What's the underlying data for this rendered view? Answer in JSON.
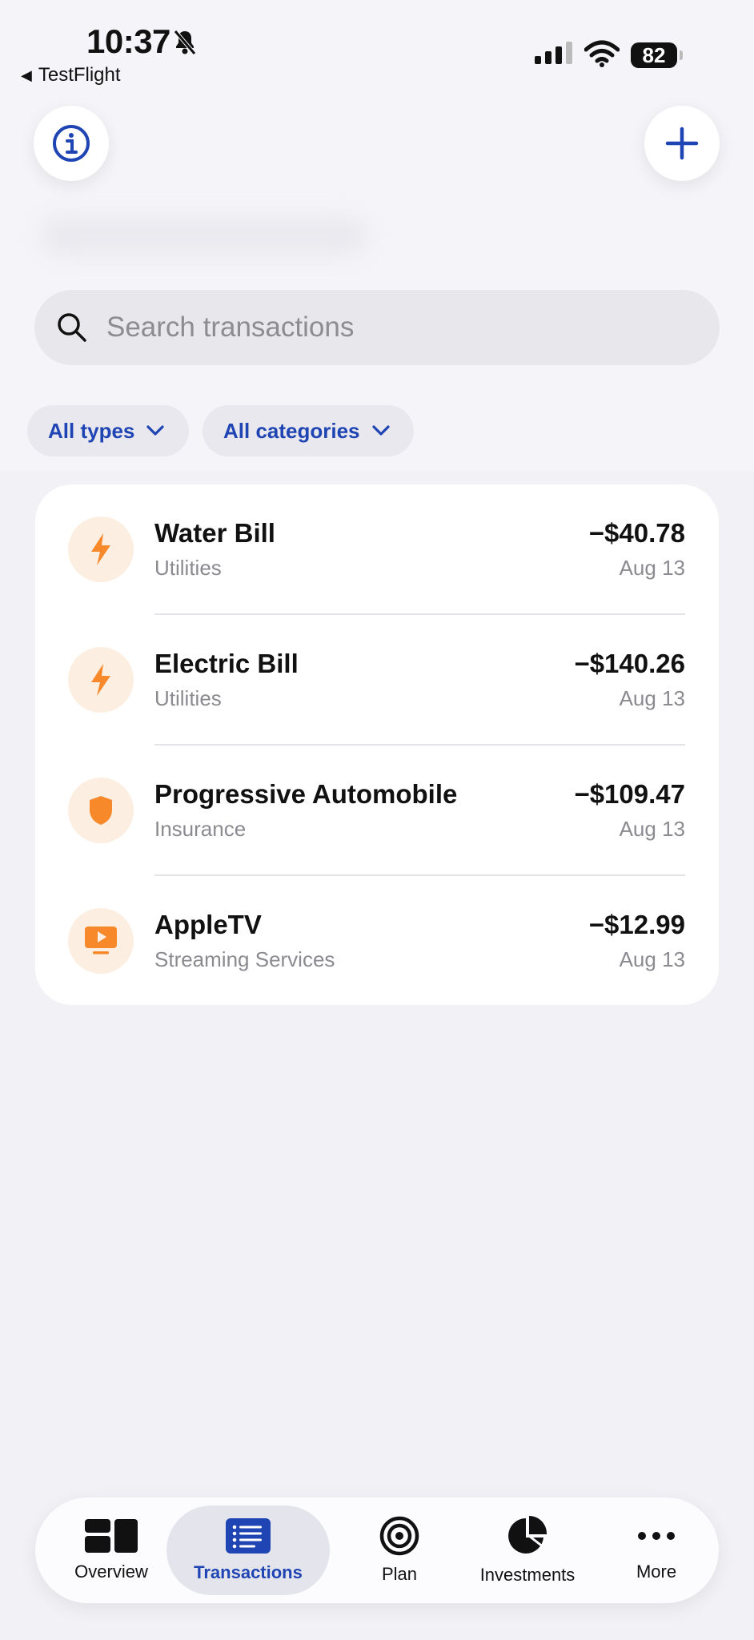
{
  "status_bar": {
    "time": "10:37",
    "back_app": "TestFlight",
    "battery": "82"
  },
  "search": {
    "placeholder": "Search transactions"
  },
  "filters": {
    "types": "All types",
    "categories": "All categories"
  },
  "transactions": [
    {
      "name": "Water Bill",
      "category": "Utilities",
      "amount": "−$40.78",
      "date": "Aug 13",
      "icon": "lightning-icon"
    },
    {
      "name": "Electric Bill",
      "category": "Utilities",
      "amount": "−$140.26",
      "date": "Aug 13",
      "icon": "lightning-icon"
    },
    {
      "name": "Progressive Automobile",
      "category": "Insurance",
      "amount": "−$109.47",
      "date": "Aug 13",
      "icon": "shield-icon"
    },
    {
      "name": "AppleTV",
      "category": "Streaming Services",
      "amount": "−$12.99",
      "date": "Aug 13",
      "icon": "tv-play-icon"
    }
  ],
  "tabs": [
    {
      "label": "Overview",
      "icon": "overview-icon"
    },
    {
      "label": "Transactions",
      "icon": "transactions-list-icon",
      "active": true
    },
    {
      "label": "Plan",
      "icon": "target-icon"
    },
    {
      "label": "Investments",
      "icon": "pie-chart-icon"
    },
    {
      "label": "More",
      "icon": "more-dots-icon"
    }
  ],
  "colors": {
    "accent": "#1f44b3",
    "icon_orange": "#f7892b",
    "icon_bg": "#fdeee2",
    "background": "#f1f1f6"
  }
}
